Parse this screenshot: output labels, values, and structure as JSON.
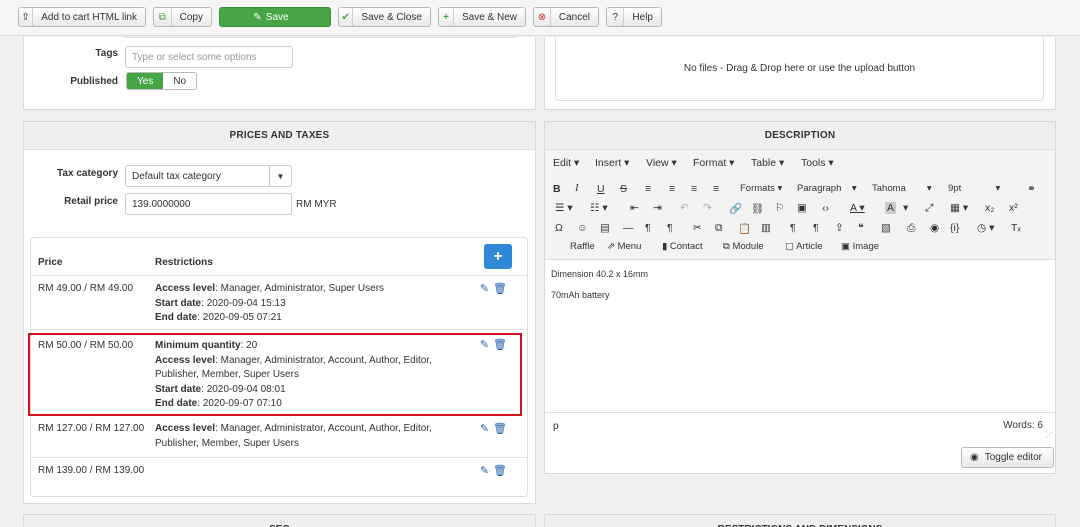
{
  "toolbar": {
    "add_cart_label": "Add to cart HTML link",
    "copy_label": "Copy",
    "save_label": "Save",
    "save_close_label": "Save & Close",
    "save_new_label": "Save & New",
    "cancel_label": "Cancel",
    "help_label": "Help"
  },
  "general": {
    "tags_label": "Tags",
    "tags_placeholder": "Type or select some options",
    "published_label": "Published",
    "published_yes": "Yes",
    "published_no": "No"
  },
  "media": {
    "dropzone_text": "No files - Drag & Drop here or use the upload button"
  },
  "prices": {
    "title": "PRICES AND TAXES",
    "tax_category_label": "Tax category",
    "tax_category_value": "Default tax category",
    "retail_price_label": "Retail price",
    "retail_price_value": "139.0000000",
    "currency": "RM MYR",
    "col_price": "Price",
    "col_restrictions": "Restrictions",
    "rows": [
      {
        "price": "RM 49.00 / RM 49.00",
        "lines": [
          {
            "key": "Access level",
            "value": "Manager, Administrator, Super Users"
          },
          {
            "key": "Start date",
            "value": "2020-09-04 15:13"
          },
          {
            "key": "End date",
            "value": "2020-09-05 07:21"
          }
        ]
      },
      {
        "price": "RM 50.00 / RM 50.00",
        "lines": [
          {
            "key": "Minimum quantity",
            "value": "20"
          },
          {
            "key": "Access level",
            "value": "Manager, Administrator, Account, Author, Editor,"
          },
          {
            "key": "",
            "value": "Publisher, Member, Super Users"
          },
          {
            "key": "Start date",
            "value": "2020-09-04 08:01"
          },
          {
            "key": "End date",
            "value": "2020-09-07 07:10"
          }
        ]
      },
      {
        "price": "RM 127.00 / RM 127.00",
        "lines": [
          {
            "key": "Access level",
            "value": "Manager, Administrator, Account, Author, Editor,"
          },
          {
            "key": "",
            "value": "Publisher, Member, Super Users"
          }
        ]
      },
      {
        "price": "RM 139.00 / RM 139.00",
        "lines": []
      }
    ]
  },
  "description": {
    "title": "DESCRIPTION",
    "menu": [
      "Edit",
      "Insert",
      "View",
      "Format",
      "Table",
      "Tools"
    ],
    "formats_label": "Formats",
    "paragraph_label": "Paragraph",
    "font_label": "Tahoma",
    "size_label": "9pt",
    "raffle_label": "Raffle",
    "menu_btn_label": "Menu",
    "contact_label": "Contact",
    "module_label": "Module",
    "article_label": "Article",
    "image_label": "Image",
    "content_line1": "Dimension 40.2 x 16mm",
    "content_line2": "70mAh battery",
    "path": "p",
    "words": "Words: 6",
    "toggle_editor": "Toggle editor"
  },
  "bottom": {
    "left_title": "SEO",
    "right_title": "RESTRICTIONS AND DIMENSIONS"
  }
}
